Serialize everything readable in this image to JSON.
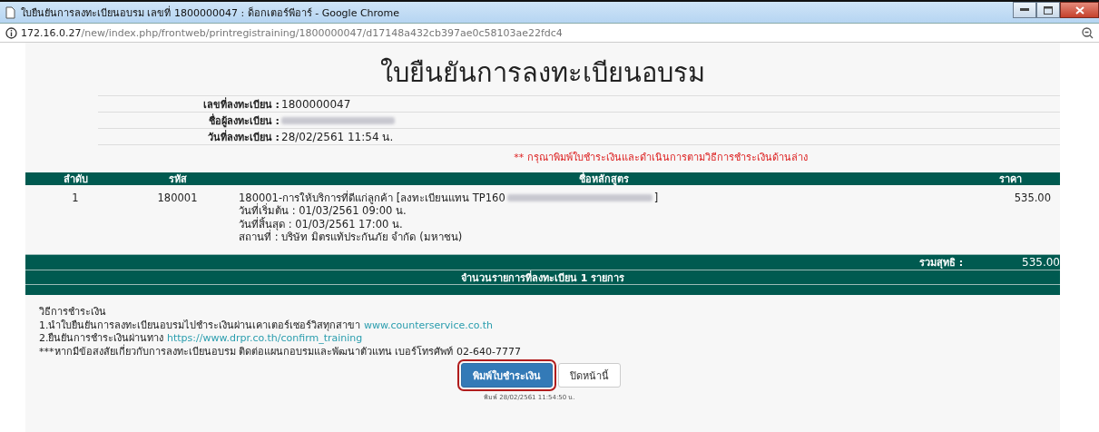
{
  "window": {
    "title": "ใบยืนยันการลงทะเบียนอบรม เลขที่ 1800000047 : ด็อกเตอร์พีอาร์ - Google Chrome"
  },
  "address_bar": {
    "host": "172.16.0.27",
    "path": "/new/index.php/frontweb/printregistraining/1800000047/d17148a432cb397ae0c58103ae22fdc4"
  },
  "page": {
    "heading": "ใบยืนยันการลงทะเบียนอบรม",
    "info_rows": [
      {
        "label": "เลขที่ลงทะเบียน :",
        "value": "1800000047",
        "redacted": false
      },
      {
        "label": "ชื่อผู้ลงทะเบียน :",
        "value": "",
        "redacted": true
      },
      {
        "label": "วันที่ลงทะเบียน :",
        "value": "28/02/2561 11:54 น.",
        "redacted": false
      }
    ],
    "notice": "** กรุณาพิมพ์ใบชำระเงินและดำเนินการตามวิธีการชำระเงินด้านล่าง",
    "table": {
      "columns": [
        "ลำดับ",
        "รหัส",
        "ชื่อหลักสูตร",
        "ราคา"
      ],
      "rows": [
        {
          "index": "1",
          "code": "180001",
          "course": "180001-การให้บริการที่ดีแก่ลูกค้า [ลงทะเบียนแทน TP160",
          "course_end": "]",
          "details": [
            "วันที่เริ่มต้น : 01/03/2561 09:00 น.",
            "วันที่สิ้นสุด : 01/03/2561 17:00 น.",
            "สถานที่ : บริษัท มิตรแท้ประกันภัย จำกัด (มหาชน)"
          ],
          "price": "535.00"
        }
      ],
      "total_label": "รวมสุทธิ :",
      "total": "535.00",
      "count": "จำนวนรายการที่ลงทะเบียน 1 รายการ"
    },
    "payment": {
      "title": "วิธีการชำระเงิน",
      "steps": [
        {
          "text": "1.นำใบยืนยันการลงทะเบียนอบรมไปชำระเงินผ่านเคาเตอร์เซอร์วิสทุกสาขา",
          "link": "www.counterservice.co.th"
        },
        {
          "text": "2.ยืนยันการชำระเงินผ่านทาง",
          "link": "https://www.drpr.co.th/confirm_training"
        }
      ],
      "contact": "***หากมีข้อสงสัยเกี่ยวกับการลงทะเบียนอบรม ติดต่อแผนกอบรมและพัฒนาตัวแทน เบอร์โทรศัพท์ 02-640-7777"
    },
    "buttons": [
      {
        "label": "พิมพ์ใบชำระเงิน",
        "kind": "primary",
        "focused": true
      },
      {
        "label": "ปิดหน้านี้",
        "kind": "default",
        "focused": false
      }
    ],
    "print_stamp": "พิมพ์ 28/02/2561 11:54:50 น."
  }
}
